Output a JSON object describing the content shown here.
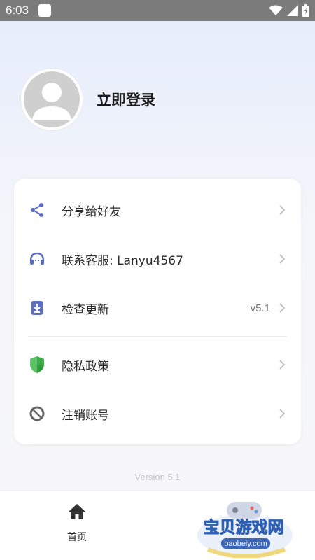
{
  "status_bar": {
    "time": "6:03"
  },
  "profile": {
    "login_label": "立即登录"
  },
  "menu": {
    "share": {
      "label": "分享给好友"
    },
    "contact": {
      "label": "联系客服: Lanyu4567"
    },
    "update": {
      "label": "检查更新",
      "value": "v5.1"
    },
    "privacy": {
      "label": "隐私政策"
    },
    "logout": {
      "label": "注销账号"
    }
  },
  "footer": {
    "version": "Version 5.1"
  },
  "bottom_nav": {
    "home_label": "首页"
  },
  "watermark": {
    "title": "宝贝游戏网",
    "url": "baobeiy.com"
  },
  "colors": {
    "icon_accent": "#5b6ec4",
    "shield": "#3fae4a",
    "chevron": "#c4c4c8"
  }
}
